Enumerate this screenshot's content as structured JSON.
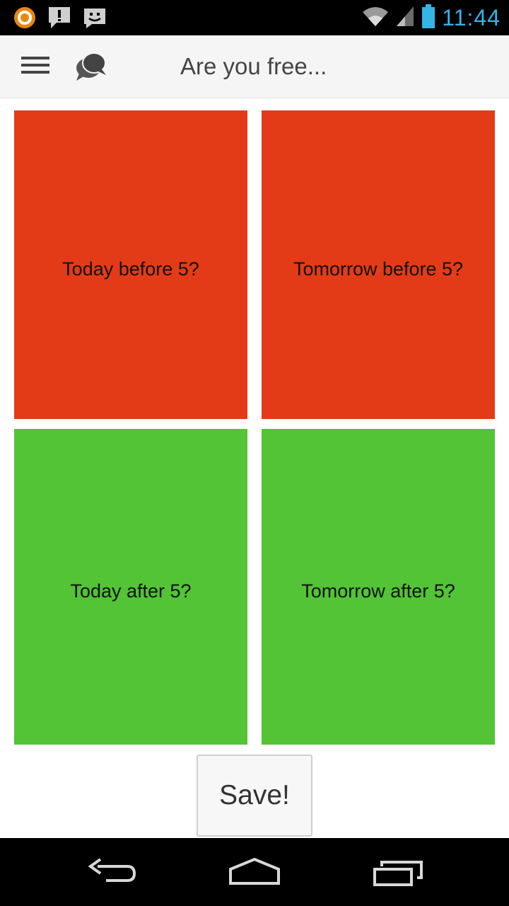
{
  "status_bar": {
    "time": "11:44",
    "icons": [
      "notification-app-icon",
      "alert-message-icon",
      "chat-face-icon",
      "wifi-icon",
      "cell-signal-icon",
      "battery-icon"
    ]
  },
  "app_bar": {
    "title": "Are you free...",
    "menu_icon": "hamburger-menu-icon",
    "logo_icon": "chat-bubbles-icon"
  },
  "slots": [
    {
      "label": "Today before 5?",
      "status": "busy"
    },
    {
      "label": "Tomorrow before 5?",
      "status": "busy"
    },
    {
      "label": "Today after 5?",
      "status": "free"
    },
    {
      "label": "Tomorrow after 5?",
      "status": "free"
    }
  ],
  "save_label": "Save!",
  "nav_bar": {
    "icons": [
      "back-icon",
      "home-icon",
      "recent-apps-icon"
    ]
  },
  "colors": {
    "busy": "#e33b17",
    "free": "#52c435",
    "status_clock": "#33b5e5"
  }
}
